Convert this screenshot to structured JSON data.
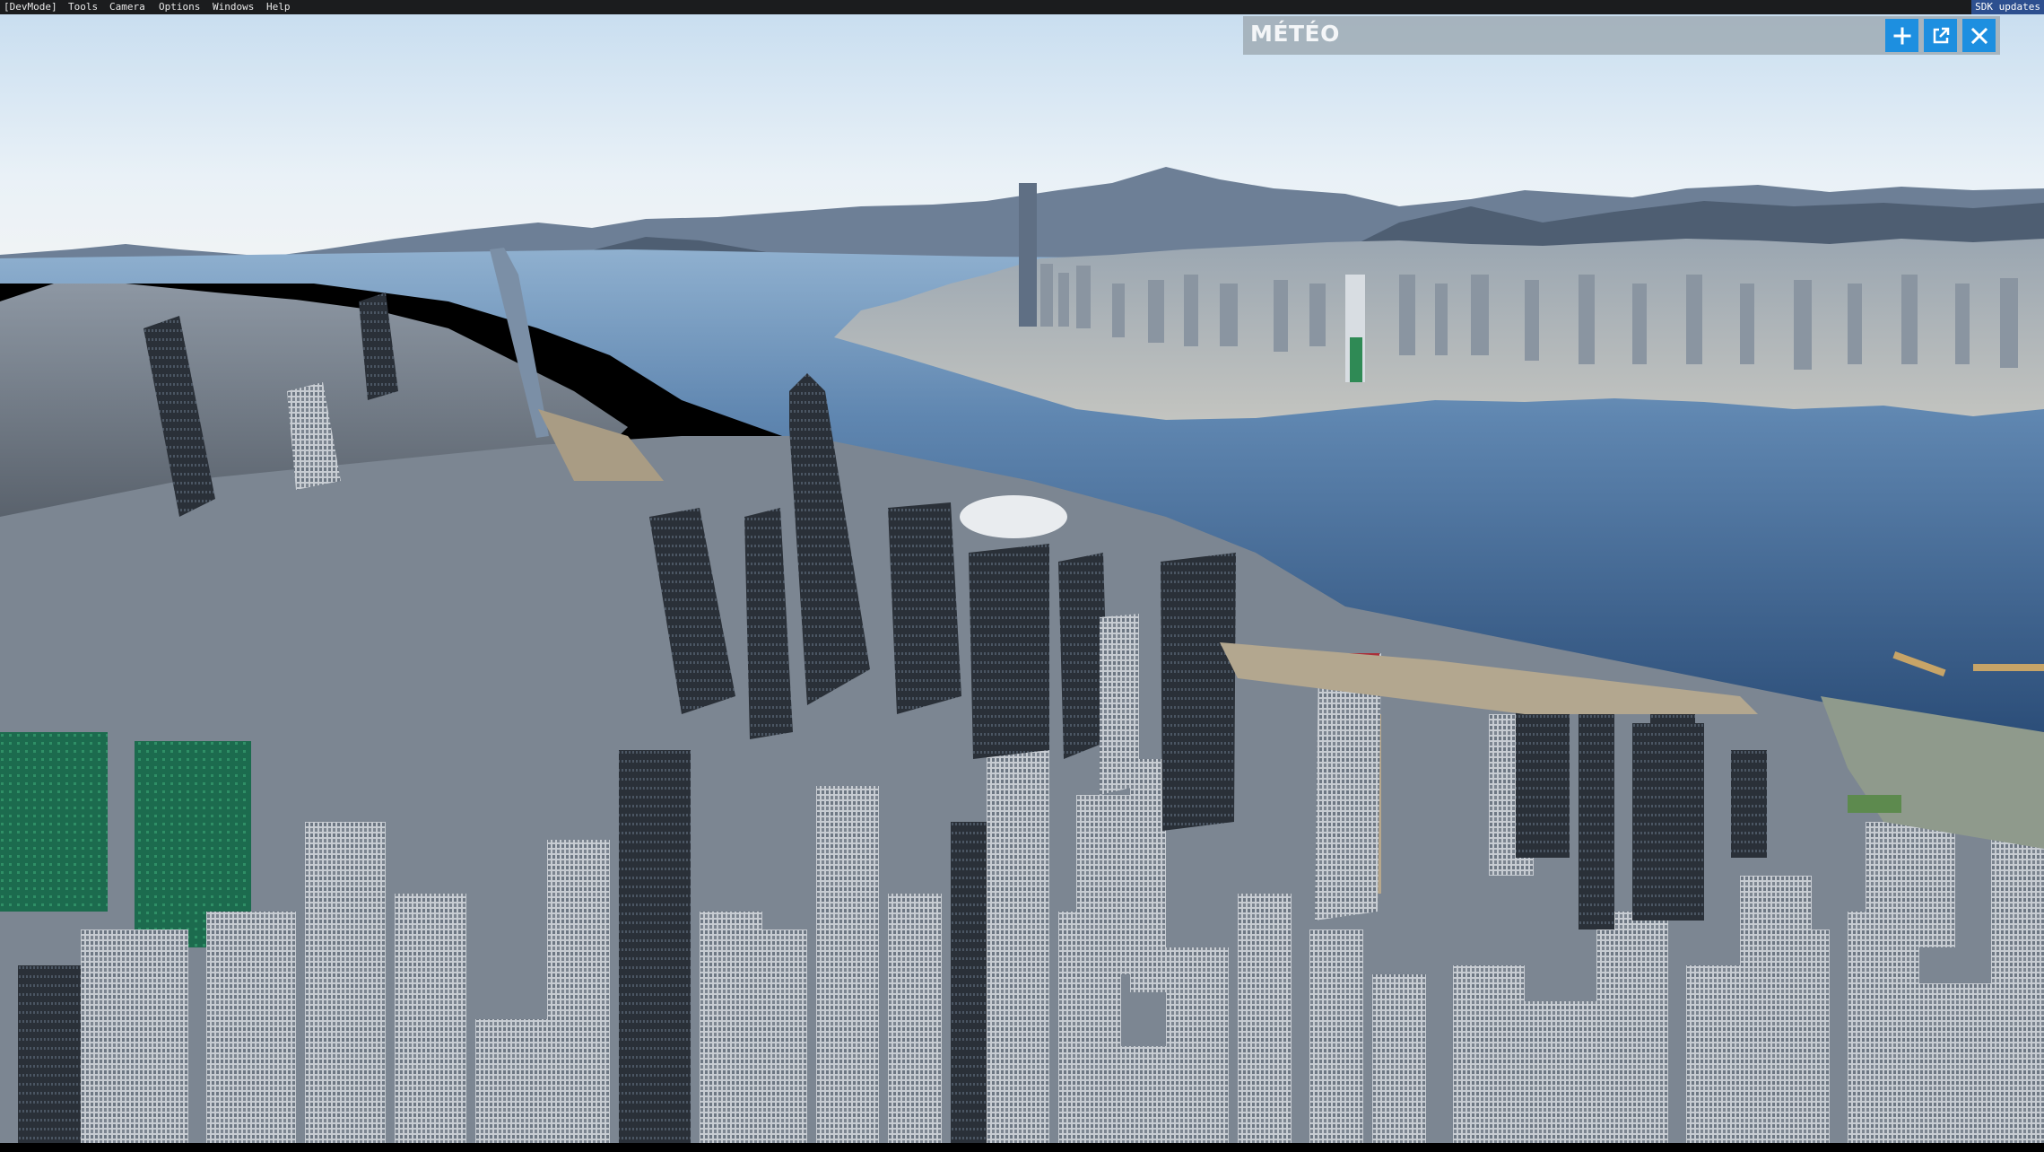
{
  "menubar": {
    "items": [
      {
        "label": "[DevMode]"
      },
      {
        "label": "Tools"
      },
      {
        "label": "Camera"
      },
      {
        "label": "Options"
      },
      {
        "label": "Windows"
      },
      {
        "label": "Help"
      }
    ],
    "sdk_label": "SDK updates"
  },
  "weather_panel": {
    "title": "MÉTÉO",
    "buttons": [
      {
        "icon": "plus-icon"
      },
      {
        "icon": "external-window-icon"
      },
      {
        "icon": "close-icon"
      }
    ],
    "accent_color": "#1d8fe0"
  }
}
